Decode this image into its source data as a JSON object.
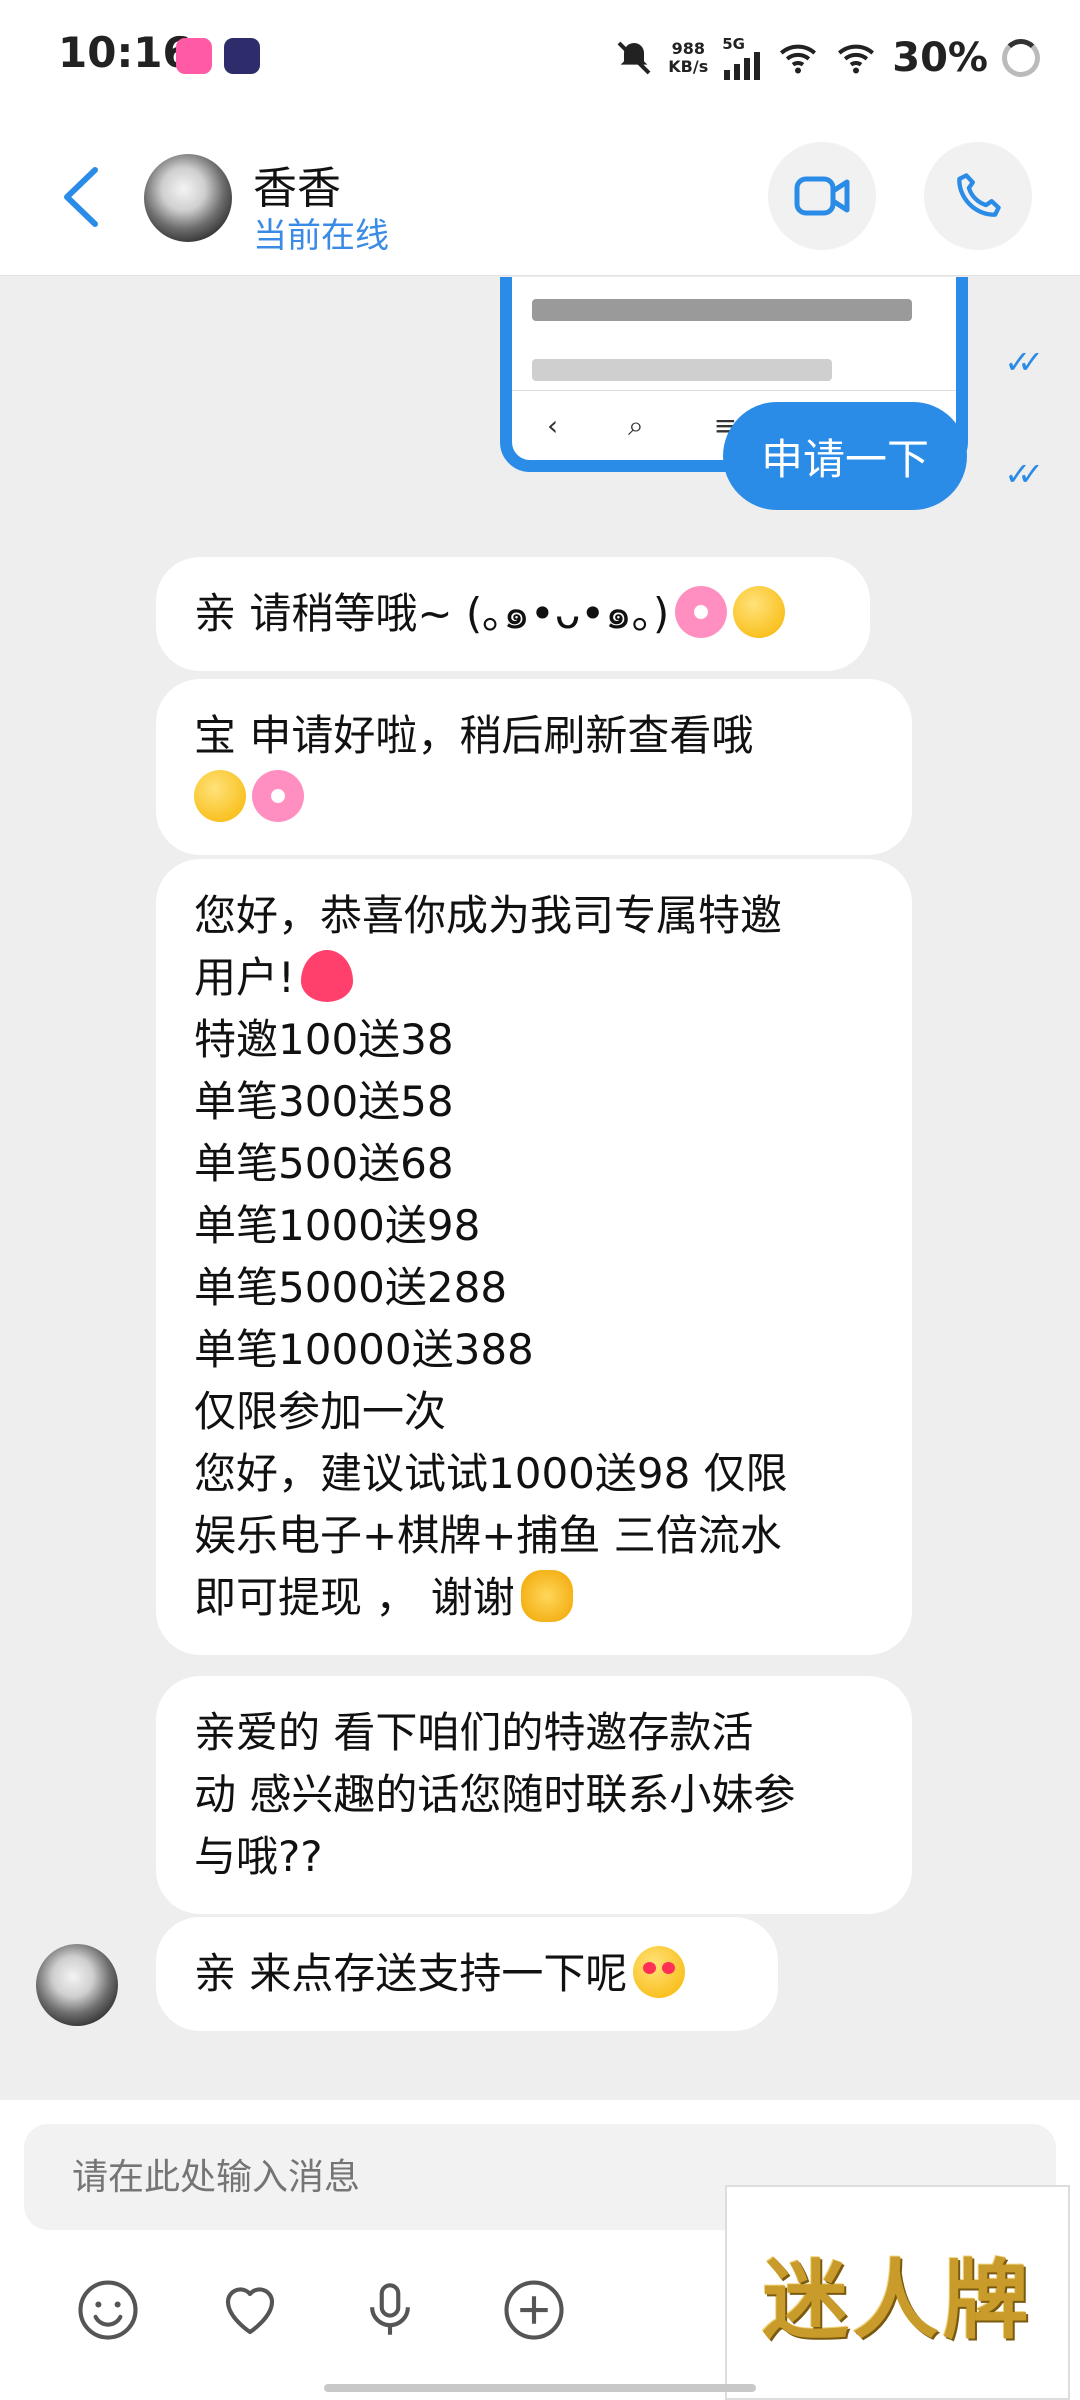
{
  "status_bar": {
    "time": "10:16",
    "speed_value": "988",
    "speed_unit": "KB/s",
    "network": "5G",
    "battery": "30%"
  },
  "header": {
    "contact_name": "香香",
    "presence": "当前在线"
  },
  "messages": {
    "outgoing_text": "申请一下",
    "m1": "亲  请稍等哦~ (｡๑•ᴗ•๑｡)",
    "m2": "宝  申请好啦，稍后刷新查看哦",
    "m3_lines": [
      "您好，恭喜你成为我司专属特邀",
      "用户!",
      "特邀100送38",
      "单笔300送58",
      "单笔500送68",
      "单笔1000送98",
      "单笔5000送288",
      "单笔10000送388",
      "仅限参加一次",
      "您好，建议试试1000送98  仅限",
      "娱乐电子+棋牌+捕鱼 三倍流水",
      "即可提现 ， 谢谢"
    ],
    "m4_lines": [
      "亲爱的  看下咱们的特邀存款活",
      "动 感兴趣的话您随时联系小妹参",
      "与哦??"
    ],
    "m5": "亲 来点存送支持一下呢"
  },
  "composer": {
    "placeholder": "请在此处输入消息"
  },
  "watermark": "迷人牌",
  "icons": {
    "back": "chevron-left-icon",
    "video": "video-camera-icon",
    "call": "phone-icon",
    "emoji": "smiley-icon",
    "like": "heart-icon",
    "voice": "microphone-icon",
    "more": "plus-circle-icon"
  },
  "colors": {
    "accent": "#2b8ce8",
    "background": "#eeeeee"
  }
}
